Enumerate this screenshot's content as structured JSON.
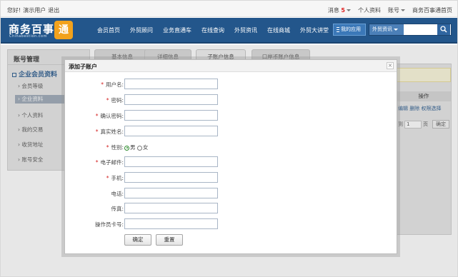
{
  "topbar": {
    "greeting": "您好!",
    "user": "演示用户",
    "logout": "退出",
    "messages_label": "消息",
    "messages_count": "5",
    "profile": "个人资料",
    "account": "账号",
    "homepage": "商务百事通首页"
  },
  "header": {
    "logo_text": "商务百事",
    "logo_domain": "Chinabestion.com",
    "logo_badge": "通",
    "nav": [
      "会员首页",
      "外贸顾问",
      "业务直通车",
      "在线查询",
      "外贸资讯",
      "在线商城",
      "外贸大讲堂"
    ],
    "my_app": "我的应用",
    "search_category": "外贸资讯"
  },
  "sidebar": {
    "title": "账号管理",
    "group": "企业会员资料",
    "items": [
      "会员等级",
      "企业资料",
      "个人资料",
      "我的交易",
      "收货地址",
      "账号安全"
    ]
  },
  "tabs": [
    "基本信息",
    "详细信息",
    "子账户信息",
    "口岸币账户信息"
  ],
  "main": {
    "column_header": "操作",
    "ops": "编辑  删除  权限选择",
    "pager_prefix": "到",
    "pager_value": "1",
    "pager_suffix": "页",
    "pager_go": "确定"
  },
  "modal": {
    "title": "添加子账户",
    "close": "×",
    "fields": [
      {
        "label": "用户名:",
        "required": "*"
      },
      {
        "label": "密码:",
        "required": "*"
      },
      {
        "label": "确认密码:",
        "required": "*"
      },
      {
        "label": "真实姓名:",
        "required": "*"
      },
      {
        "label": "性别:",
        "required": "*"
      },
      {
        "label": "电子邮件:",
        "required": "*"
      },
      {
        "label": "手机:",
        "required": "*"
      },
      {
        "label": "电话:",
        "required": ""
      },
      {
        "label": "传真:",
        "required": ""
      },
      {
        "label": "操作员卡号:",
        "required": ""
      }
    ],
    "gender_male": "男",
    "gender_female": "女",
    "gender_selected": "男",
    "confirm": "确定",
    "reset": "重置"
  }
}
